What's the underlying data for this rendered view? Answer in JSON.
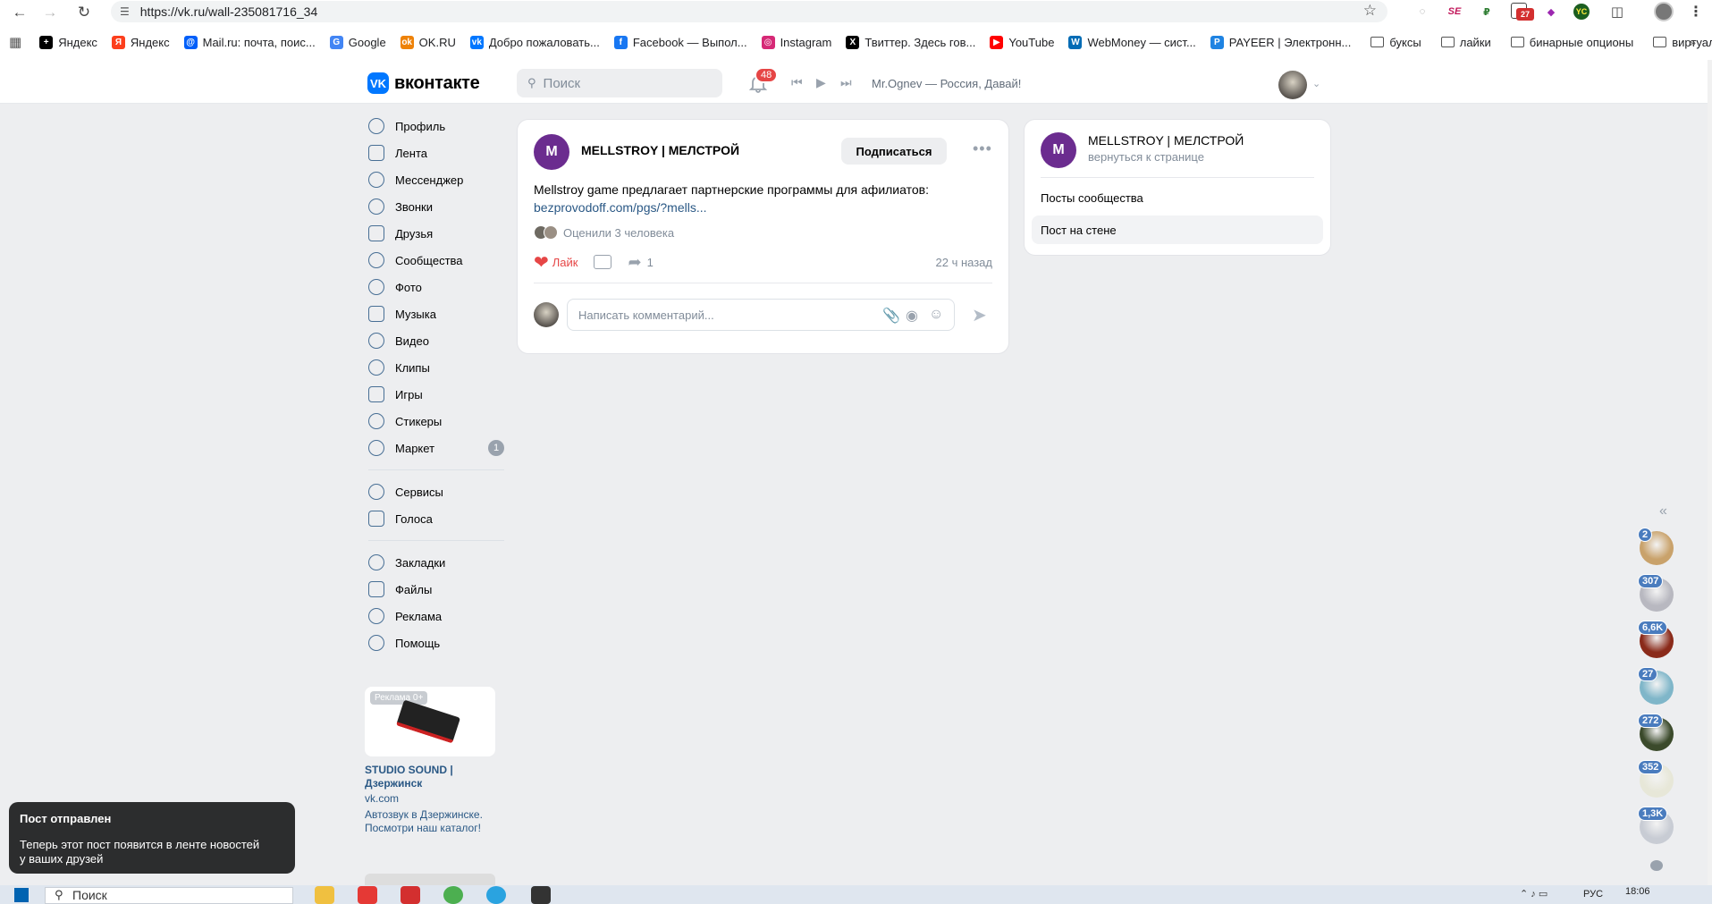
{
  "browser": {
    "url": "https://vk.ru/wall-235081716_34",
    "bookmarks": [
      {
        "label": "Яндекс",
        "color": "#000000",
        "glyph": "+"
      },
      {
        "label": "Яндекс",
        "color": "#fc3f1d",
        "glyph": "Я"
      },
      {
        "label": "Mail.ru: почта, поис...",
        "color": "#005ff9",
        "glyph": "@"
      },
      {
        "label": "Google",
        "color": "#4285f4",
        "glyph": "G"
      },
      {
        "label": "OK.RU",
        "color": "#ee8208",
        "glyph": "ok"
      },
      {
        "label": "Добро пожаловать...",
        "color": "#0077ff",
        "glyph": "vk"
      },
      {
        "label": "Facebook — Выпол...",
        "color": "#1877f2",
        "glyph": "f"
      },
      {
        "label": "Instagram",
        "color": "#d62976",
        "glyph": "◎"
      },
      {
        "label": "Твиттер. Здесь гов...",
        "color": "#000000",
        "glyph": "X"
      },
      {
        "label": "YouTube",
        "color": "#ff0000",
        "glyph": "▶"
      },
      {
        "label": "WebMoney — сист...",
        "color": "#036cb5",
        "glyph": "W"
      },
      {
        "label": "PAYEER | Электронн...",
        "color": "#1f83e2",
        "glyph": "P"
      }
    ],
    "folders": [
      "буксы",
      "лайки",
      "бинарные опционы",
      "виртуально"
    ],
    "ext_badge": "27"
  },
  "header": {
    "logo": "вконтакте",
    "search_placeholder": "Поиск",
    "notifications": "48",
    "now_playing": "Mr.Ognev — Россия, Давай!"
  },
  "sidebar": {
    "items": [
      {
        "label": "Профиль",
        "icon": "profile-icon"
      },
      {
        "label": "Лента",
        "icon": "feed-icon"
      },
      {
        "label": "Мессенджер",
        "icon": "messenger-icon"
      },
      {
        "label": "Звонки",
        "icon": "phone-icon"
      },
      {
        "label": "Друзья",
        "icon": "friends-icon"
      },
      {
        "label": "Сообщества",
        "icon": "communities-icon"
      },
      {
        "label": "Фото",
        "icon": "photo-icon"
      },
      {
        "label": "Музыка",
        "icon": "music-icon"
      },
      {
        "label": "Видео",
        "icon": "video-icon"
      },
      {
        "label": "Клипы",
        "icon": "clips-icon"
      },
      {
        "label": "Игры",
        "icon": "games-icon"
      },
      {
        "label": "Стикеры",
        "icon": "stickers-icon"
      },
      {
        "label": "Маркет",
        "icon": "market-icon",
        "badge": "1"
      }
    ],
    "group2": [
      {
        "label": "Сервисы",
        "icon": "services-icon"
      },
      {
        "label": "Голоса",
        "icon": "votes-icon"
      }
    ],
    "group3": [
      {
        "label": "Закладки",
        "icon": "bookmark-icon"
      },
      {
        "label": "Файлы",
        "icon": "files-icon"
      },
      {
        "label": "Реклама",
        "icon": "ads-icon"
      },
      {
        "label": "Помощь",
        "icon": "help-icon"
      }
    ]
  },
  "ad": {
    "tag": "Реклама 0+",
    "title": "STUDIO SOUND | Дзержинск",
    "domain": "vk.com",
    "text": "Автозвук в Дзержинске. Посмотри наш каталог!"
  },
  "post": {
    "group_name": "MELLSTROY | МЕЛСТРОЙ",
    "subscribe": "Подписаться",
    "text": "Mellstroy game предлагает партнерские программы для афилиатов:",
    "link": "bezprovodoff.com/pgs/?mells...",
    "liked_by": "Оценили 3 человека",
    "like_label": "Лайк",
    "shares": "1",
    "time": "22 ч назад",
    "comment_placeholder": "Написать комментарий..."
  },
  "right_card": {
    "group_name": "MELLSTROY | МЕЛСТРОЙ",
    "back": "вернуться к странице",
    "menu": [
      "Посты сообщества",
      "Пост на стене"
    ]
  },
  "chats": [
    {
      "count": "2",
      "color": "#c9a26b"
    },
    {
      "count": "307",
      "color": "#b8b8c0"
    },
    {
      "count": "6,6K",
      "color": "#8a2a1a"
    },
    {
      "count": "27",
      "color": "#7fb6c9"
    },
    {
      "count": "272",
      "color": "#3b4a2b"
    },
    {
      "count": "352",
      "color": "#e7e7d8"
    },
    {
      "count": "1,3K",
      "color": "#c8ccd4"
    }
  ],
  "toast": {
    "title": "Пост отправлен",
    "body": "Теперь этот пост появится в ленте новостей у ваших друзей"
  },
  "taskbar": {
    "search": "Поиск",
    "lang": "РУС",
    "time": "18:06"
  }
}
